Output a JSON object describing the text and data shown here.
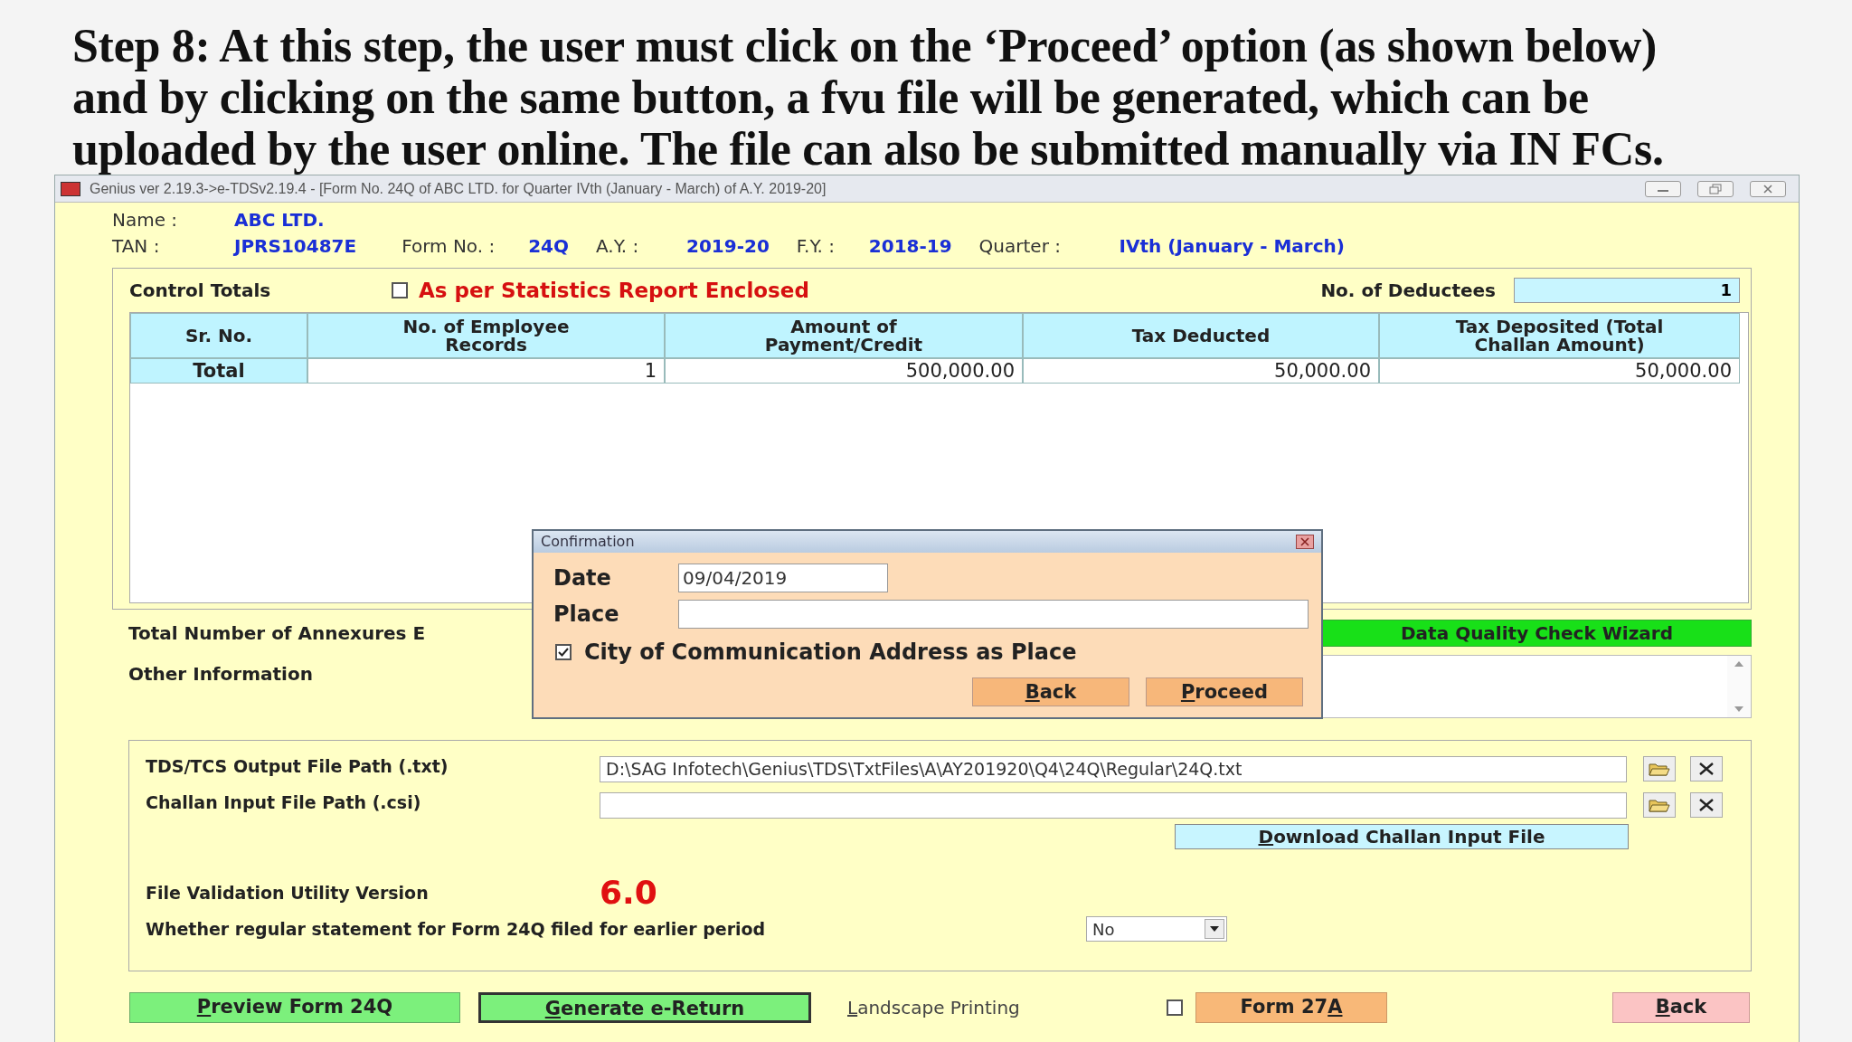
{
  "slide_heading": "Step 8: At this step, the user must click on the ‘Proceed’ option (as shown below) and by clicking on the same button, a fvu file will be generated, which can be uploaded by the user online. The file can also be submitted manually via IN FCs.",
  "window": {
    "title": "Genius ver 2.19.3->e-TDSv2.19.4 - [Form No. 24Q of ABC LTD. for Quarter IVth (January - March) of A.Y. 2019-20]"
  },
  "header": {
    "name_label": "Name :",
    "name_value": "ABC LTD.",
    "fields": [
      {
        "label": "TAN :",
        "value": "JPRS10487E"
      },
      {
        "label": "Form No. :",
        "value": "24Q"
      },
      {
        "label": "A.Y. :",
        "value": "2019-20"
      },
      {
        "label": "F.Y. :",
        "value": "2018-19"
      },
      {
        "label": "Quarter :",
        "value": "IVth (January - March)"
      }
    ]
  },
  "control_totals": {
    "title": "Control Totals",
    "statistics_checkbox": {
      "label": "As per Statistics Report Enclosed",
      "checked": false
    },
    "deductees_label": "No. of Deductees",
    "deductees_value": "1",
    "table": {
      "columns": [
        "Sr. No.",
        "No. of Employee Records",
        "Amount of Payment/Credit",
        "Tax Deducted",
        "Tax Deposited (Total Challan Amount)"
      ],
      "rows": [
        [
          "Total",
          "1",
          "500,000.00",
          "50,000.00",
          "50,000.00"
        ]
      ]
    }
  },
  "annexures_label": "Total Number of Annexures E",
  "data_quality_button": "Data Quality Check Wizard",
  "other_information_label": "Other Information",
  "files": {
    "rows": [
      {
        "label": "TDS/TCS Output File Path (.txt)",
        "value": "D:\\SAG Infotech\\Genius\\TDS\\TxtFiles\\A\\AY201920\\Q4\\24Q\\Regular\\24Q.txt"
      },
      {
        "label": "Challan Input File Path (.csi)"
      }
    ],
    "download_button": {
      "hotkey": "D",
      "text_after": "ownload Challan Input File"
    },
    "fvu_label": "File Validation Utility Version",
    "fvu_version": "6.0",
    "regular_statement_label": "Whether regular statement for Form 24Q filed for earlier period",
    "regular_statement_value": "No"
  },
  "footer": [
    {
      "kind": "primary",
      "hotkey": "P",
      "text_after": "review Form 24Q"
    },
    {
      "kind": "primary_outlined",
      "hotkey": "G",
      "text_after": "enerate e-Return"
    },
    {
      "kind": "toggle",
      "hotkey": "L",
      "text_after": "andscape Printing",
      "checked": false
    },
    {
      "kind": "form",
      "text_before": "Form 27",
      "hotkey": "A"
    },
    {
      "kind": "back",
      "hotkey": "B",
      "text_after": "ack"
    }
  ],
  "dialog": {
    "title": "Confirmation",
    "date_label": "Date",
    "date_value": "09/04/2019",
    "place_label": "Place",
    "city_checkbox": {
      "label": "City of Communication Address as Place",
      "checked": true
    },
    "buttons": [
      {
        "hotkey": "B",
        "text_after": "ack"
      },
      {
        "hotkey": "P",
        "text_after": "roceed"
      }
    ]
  }
}
